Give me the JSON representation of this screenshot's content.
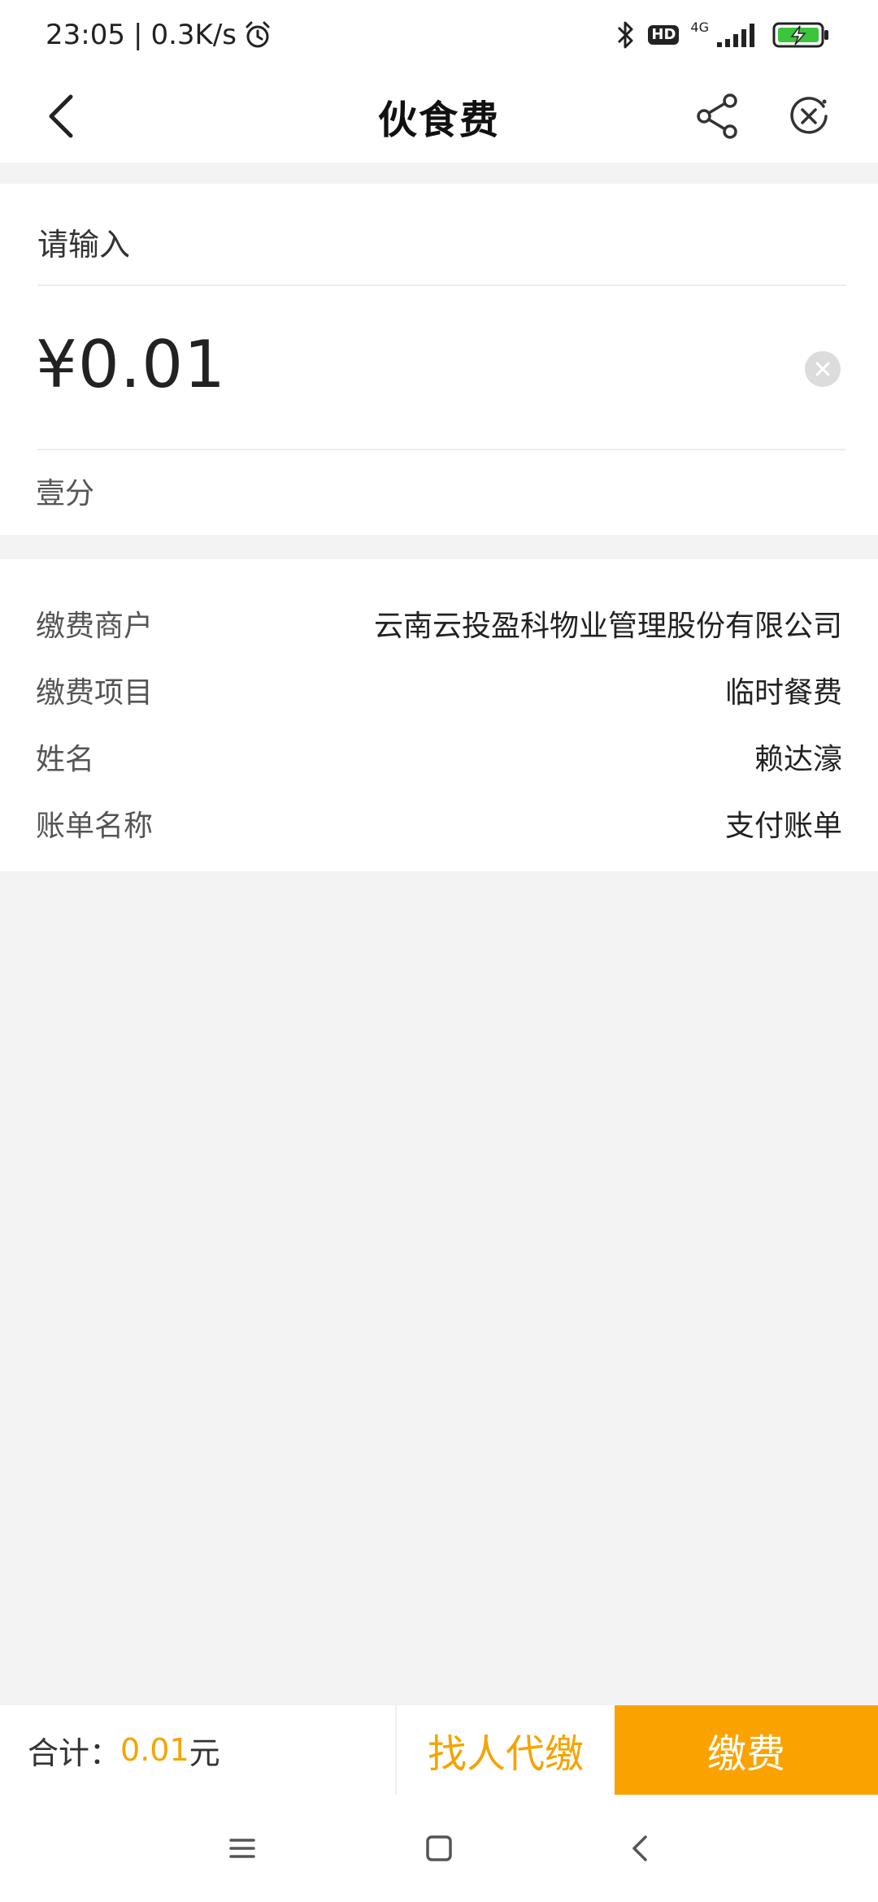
{
  "status_bar": {
    "time": "23:05",
    "separator": "|",
    "net_speed": "0.3K/s",
    "hd_label": "HD",
    "network_label": "4G"
  },
  "nav": {
    "title": "伙食费"
  },
  "payment_form": {
    "remark_placeholder": "请输入",
    "amount": "¥0.01",
    "amount_in_words": "壹分"
  },
  "details": [
    {
      "label": "缴费商户",
      "value": "云南云投盈科物业管理股份有限公司"
    },
    {
      "label": "缴费项目",
      "value": "临时餐费"
    },
    {
      "label": "姓名",
      "value": "赖达濠"
    },
    {
      "label": "账单名称",
      "value": "支付账单"
    }
  ],
  "bottom_bar": {
    "total_label": "合计：",
    "total_amount": "0.01",
    "total_unit": "元",
    "proxy_pay_label": "找人代缴",
    "pay_label": "缴费"
  },
  "colors": {
    "accent": "#faa300",
    "accent_text": "#f5a400",
    "background": "#f3f3f3"
  },
  "icons": {
    "back": "chevron-left-icon",
    "share": "share-icon",
    "close": "close-circle-icon",
    "clear": "clear-icon",
    "alarm": "alarm-icon",
    "bluetooth": "bluetooth-icon",
    "signal": "signal-icon",
    "battery": "battery-charging-icon",
    "menu": "menu-icon",
    "home": "home-square-icon",
    "system_back": "system-back-icon"
  }
}
